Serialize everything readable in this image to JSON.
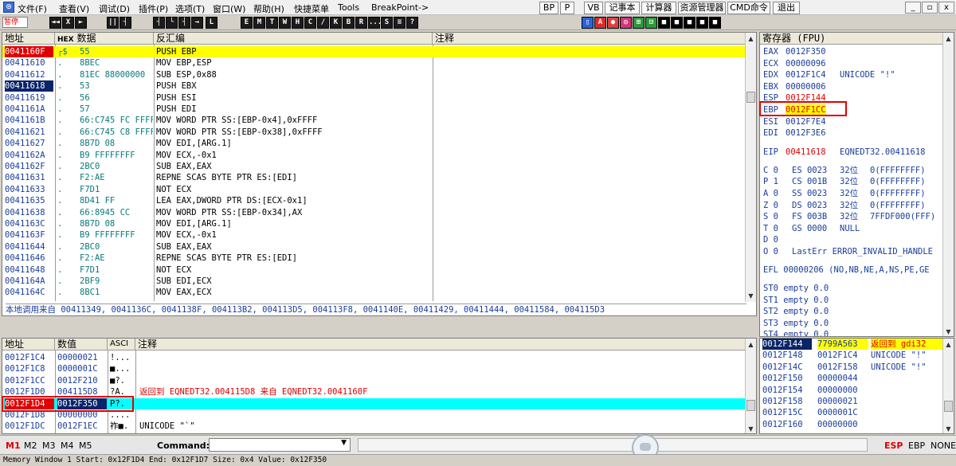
{
  "menubar": {
    "items": [
      "文件(F)",
      "查看(V)",
      "调试(D)",
      "插件(P)",
      "选项(T)",
      "窗口(W)",
      "帮助(H)",
      "快捷菜单",
      "Tools",
      "BreakPoint->"
    ],
    "quick_buttons": [
      "BP",
      "P",
      "VB",
      "记事本",
      "计算器",
      "资源管理器",
      "CMD命令",
      "退出"
    ],
    "window_buttons": [
      "_",
      "▫",
      "x"
    ]
  },
  "toolbar": {
    "status": "暂停",
    "buttons": [
      "◄◄",
      "X",
      "►",
      "||",
      "┤",
      "┤",
      "└",
      "┤",
      "→",
      "L",
      "E",
      "M",
      "T",
      "W",
      "H",
      "C",
      "/",
      "K",
      "B",
      "R",
      "...",
      "S",
      "≡",
      "?"
    ],
    "color_buttons": [
      "▯",
      "A",
      "●",
      "◎",
      "⊞",
      "⊟",
      "■",
      "■",
      "■",
      "■",
      "■"
    ]
  },
  "disasm": {
    "headers": {
      "addr": "地址",
      "hex_badge": "HEX",
      "hex": "数据",
      "dis": "反汇编",
      "comment": "注释"
    },
    "rows": [
      {
        "addr": "0041160F",
        "mark": "┌$",
        "hex": "55",
        "dis": "PUSH EBP"
      },
      {
        "addr": "00411610",
        "mark": ".",
        "hex": "8BEC",
        "dis": "MOV EBP,ESP"
      },
      {
        "addr": "00411612",
        "mark": ".",
        "hex": "81EC 88000000",
        "dis": "SUB ESP,0x88"
      },
      {
        "addr": "00411618",
        "mark": ".",
        "hex": "53",
        "dis": "PUSH EBX"
      },
      {
        "addr": "00411619",
        "mark": ".",
        "hex": "56",
        "dis": "PUSH ESI"
      },
      {
        "addr": "0041161A",
        "mark": ".",
        "hex": "57",
        "dis": "PUSH EDI"
      },
      {
        "addr": "0041161B",
        "mark": ".",
        "hex": "66:C745 FC FFFF",
        "dis": "MOV WORD PTR SS:[EBP-0x4],0xFFFF"
      },
      {
        "addr": "00411621",
        "mark": ".",
        "hex": "66:C745 C8 FFFF",
        "dis": "MOV WORD PTR SS:[EBP-0x38],0xFFFF"
      },
      {
        "addr": "00411627",
        "mark": ".",
        "hex": "8B7D 08",
        "dis": "MOV EDI,[ARG.1]"
      },
      {
        "addr": "0041162A",
        "mark": ".",
        "hex": "B9 FFFFFFFF",
        "dis": "MOV ECX,-0x1"
      },
      {
        "addr": "0041162F",
        "mark": ".",
        "hex": "2BC0",
        "dis": "SUB EAX,EAX"
      },
      {
        "addr": "00411631",
        "mark": ".",
        "hex": "F2:AE",
        "dis": "REPNE SCAS BYTE PTR ES:[EDI]"
      },
      {
        "addr": "00411633",
        "mark": ".",
        "hex": "F7D1",
        "dis": "NOT ECX"
      },
      {
        "addr": "00411635",
        "mark": ".",
        "hex": "8D41 FF",
        "dis": "LEA EAX,DWORD PTR DS:[ECX-0x1]"
      },
      {
        "addr": "00411638",
        "mark": ".",
        "hex": "66:8945 CC",
        "dis": "MOV WORD PTR SS:[EBP-0x34],AX"
      },
      {
        "addr": "0041163C",
        "mark": ".",
        "hex": "8B7D 08",
        "dis": "MOV EDI,[ARG.1]"
      },
      {
        "addr": "0041163F",
        "mark": ".",
        "hex": "B9 FFFFFFFF",
        "dis": "MOV ECX,-0x1"
      },
      {
        "addr": "00411644",
        "mark": ".",
        "hex": "2BC0",
        "dis": "SUB EAX,EAX"
      },
      {
        "addr": "00411646",
        "mark": ".",
        "hex": "F2:AE",
        "dis": "REPNE SCAS BYTE PTR ES:[EDI]"
      },
      {
        "addr": "00411648",
        "mark": ".",
        "hex": "F7D1",
        "dis": "NOT ECX"
      },
      {
        "addr": "0041164A",
        "mark": ".",
        "hex": "2BF9",
        "dis": "SUB EDI,ECX"
      },
      {
        "addr": "0041164C",
        "mark": ".",
        "hex": "8BC1",
        "dis": "MOV EAX,ECX"
      }
    ],
    "info_text": "本地调用来自 00411349, 0041136C, 0041138F, 004113B2, 004113D5, 004113F8, 0041140E, 00411429, 00411444, 00411584, 004115D3"
  },
  "registers": {
    "header": "寄存器 (FPU)",
    "gp": [
      {
        "name": "EAX",
        "val": "0012F350",
        "extra": ""
      },
      {
        "name": "ECX",
        "val": "00000096",
        "extra": ""
      },
      {
        "name": "EDX",
        "val": "0012F1C4",
        "extra": "UNICODE \"!\""
      },
      {
        "name": "EBX",
        "val": "00000006",
        "extra": ""
      },
      {
        "name": "ESP",
        "val": "0012F144",
        "extra": ""
      },
      {
        "name": "EBP",
        "val": "0012F1CC",
        "extra": ""
      },
      {
        "name": "ESI",
        "val": "0012F7E4",
        "extra": ""
      },
      {
        "name": "EDI",
        "val": "0012F3E6",
        "extra": ""
      }
    ],
    "eip": {
      "name": "EIP",
      "val": "00411618",
      "extra": "EQNEDT32.00411618"
    },
    "flags": [
      {
        "f": "C 0",
        "seg": "ES 0023",
        "bits": "32位",
        "base": "0(FFFFFFFF)"
      },
      {
        "f": "P 1",
        "seg": "CS 001B",
        "bits": "32位",
        "base": "0(FFFFFFFF)"
      },
      {
        "f": "A 0",
        "seg": "SS 0023",
        "bits": "32位",
        "base": "0(FFFFFFFF)"
      },
      {
        "f": "Z 0",
        "seg": "DS 0023",
        "bits": "32位",
        "base": "0(FFFFFFFF)"
      },
      {
        "f": "S 0",
        "seg": "FS 003B",
        "bits": "32位",
        "base": "7FFDF000(FFF)"
      },
      {
        "f": "T 0",
        "seg": "GS 0000",
        "bits": "NULL",
        "base": ""
      }
    ],
    "d_flag": "D 0",
    "o_flag": "O 0",
    "lasterr": "LastErr ERROR_INVALID_HANDLE",
    "efl": "EFL 00000206 (NO,NB,NE,A,NS,PE,GE",
    "fpu": [
      "ST0 empty 0.0",
      "ST1 empty 0.0",
      "ST2 empty 0.0",
      "ST3 empty 0.0",
      "ST4 empty 0.0"
    ]
  },
  "dump": {
    "headers": {
      "addr": "地址",
      "val": "数值",
      "ascii": "ASCI",
      "comment": "注释"
    },
    "rows": [
      {
        "addr": "0012F1C4",
        "val": "00000021",
        "ascii": "!...",
        "comment": ""
      },
      {
        "addr": "0012F1C8",
        "val": "0000001C",
        "ascii": "■...",
        "comment": ""
      },
      {
        "addr": "0012F1CC",
        "val": "0012F210",
        "ascii": "■?.",
        "comment": ""
      },
      {
        "addr": "0012F1D0",
        "val": "004115D8",
        "ascii": "?A.",
        "comment": "返回到 EQNEDT32.004115D8 来自 EQNEDT32.0041160F"
      },
      {
        "addr": "0012F1D4",
        "val": "0012F350",
        "ascii": "P?.",
        "comment": ""
      },
      {
        "addr": "0012F1D8",
        "val": "00000000",
        "ascii": "....",
        "comment": ""
      },
      {
        "addr": "0012F1DC",
        "val": "0012F1EC",
        "ascii": "祚■.",
        "comment": "UNICODE \"`\""
      }
    ]
  },
  "stack": {
    "rows": [
      {
        "addr": "0012F144",
        "val": "7799A563",
        "comment": "返回到 gdi32"
      },
      {
        "addr": "0012F148",
        "val": "0012F1C4",
        "comment": "UNICODE \"!\""
      },
      {
        "addr": "0012F14C",
        "val": "0012F158",
        "comment": "UNICODE \"!\""
      },
      {
        "addr": "0012F150",
        "val": "00000044",
        "comment": ""
      },
      {
        "addr": "0012F154",
        "val": "00000000",
        "comment": ""
      },
      {
        "addr": "0012F158",
        "val": "00000021",
        "comment": ""
      },
      {
        "addr": "0012F15C",
        "val": "0000001C",
        "comment": ""
      },
      {
        "addr": "0012F160",
        "val": "00000000",
        "comment": ""
      }
    ]
  },
  "bottombar": {
    "mem_tabs": [
      "M1",
      "M2",
      "M3",
      "M4",
      "M5"
    ],
    "command_label": "Command:",
    "command_value": "",
    "right_labels": [
      "ESP",
      "EBP",
      "NONE"
    ]
  },
  "statusline": "Memory Window 1  Start: 0x12F1D4  End: 0x12F1D7  Size: 0x4 Value: 0x12F350",
  "colors": {
    "accent_red": "#e00000",
    "highlight_yellow": "#ffff00",
    "highlight_cyan": "#00ffff",
    "select_blue": "#0a246a"
  }
}
